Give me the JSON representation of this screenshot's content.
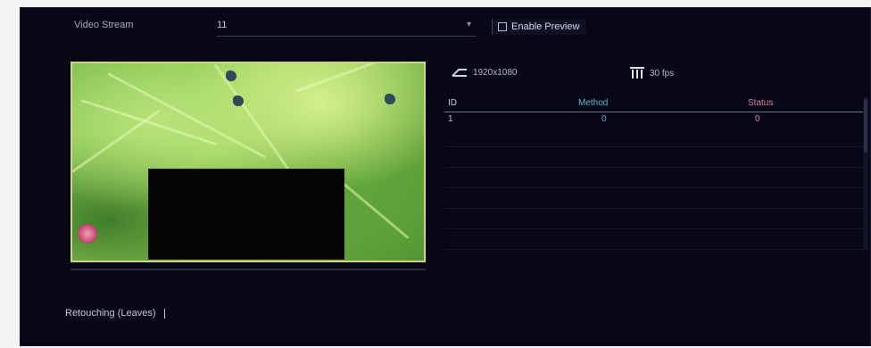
{
  "settings": {
    "label": "Video Stream",
    "selected_value": "11",
    "checkbox_label": "Enable Preview"
  },
  "video_info": {
    "resolution": "1920x1080",
    "framerate": "30 fps"
  },
  "table": {
    "columns": [
      "ID",
      "Method",
      "Status"
    ],
    "rows": [
      {
        "id": "1",
        "method": "0",
        "status": "0"
      }
    ]
  },
  "description": {
    "text": "Retouching (Leaves) ",
    "placeholder": ""
  },
  "playback": {
    "progress": 0.0
  },
  "colors": {
    "background": "#070716",
    "preview_border": "#cfd38a",
    "column_method": "#62b4d6",
    "column_status": "#d783a6",
    "text": "#c4c6d6"
  }
}
